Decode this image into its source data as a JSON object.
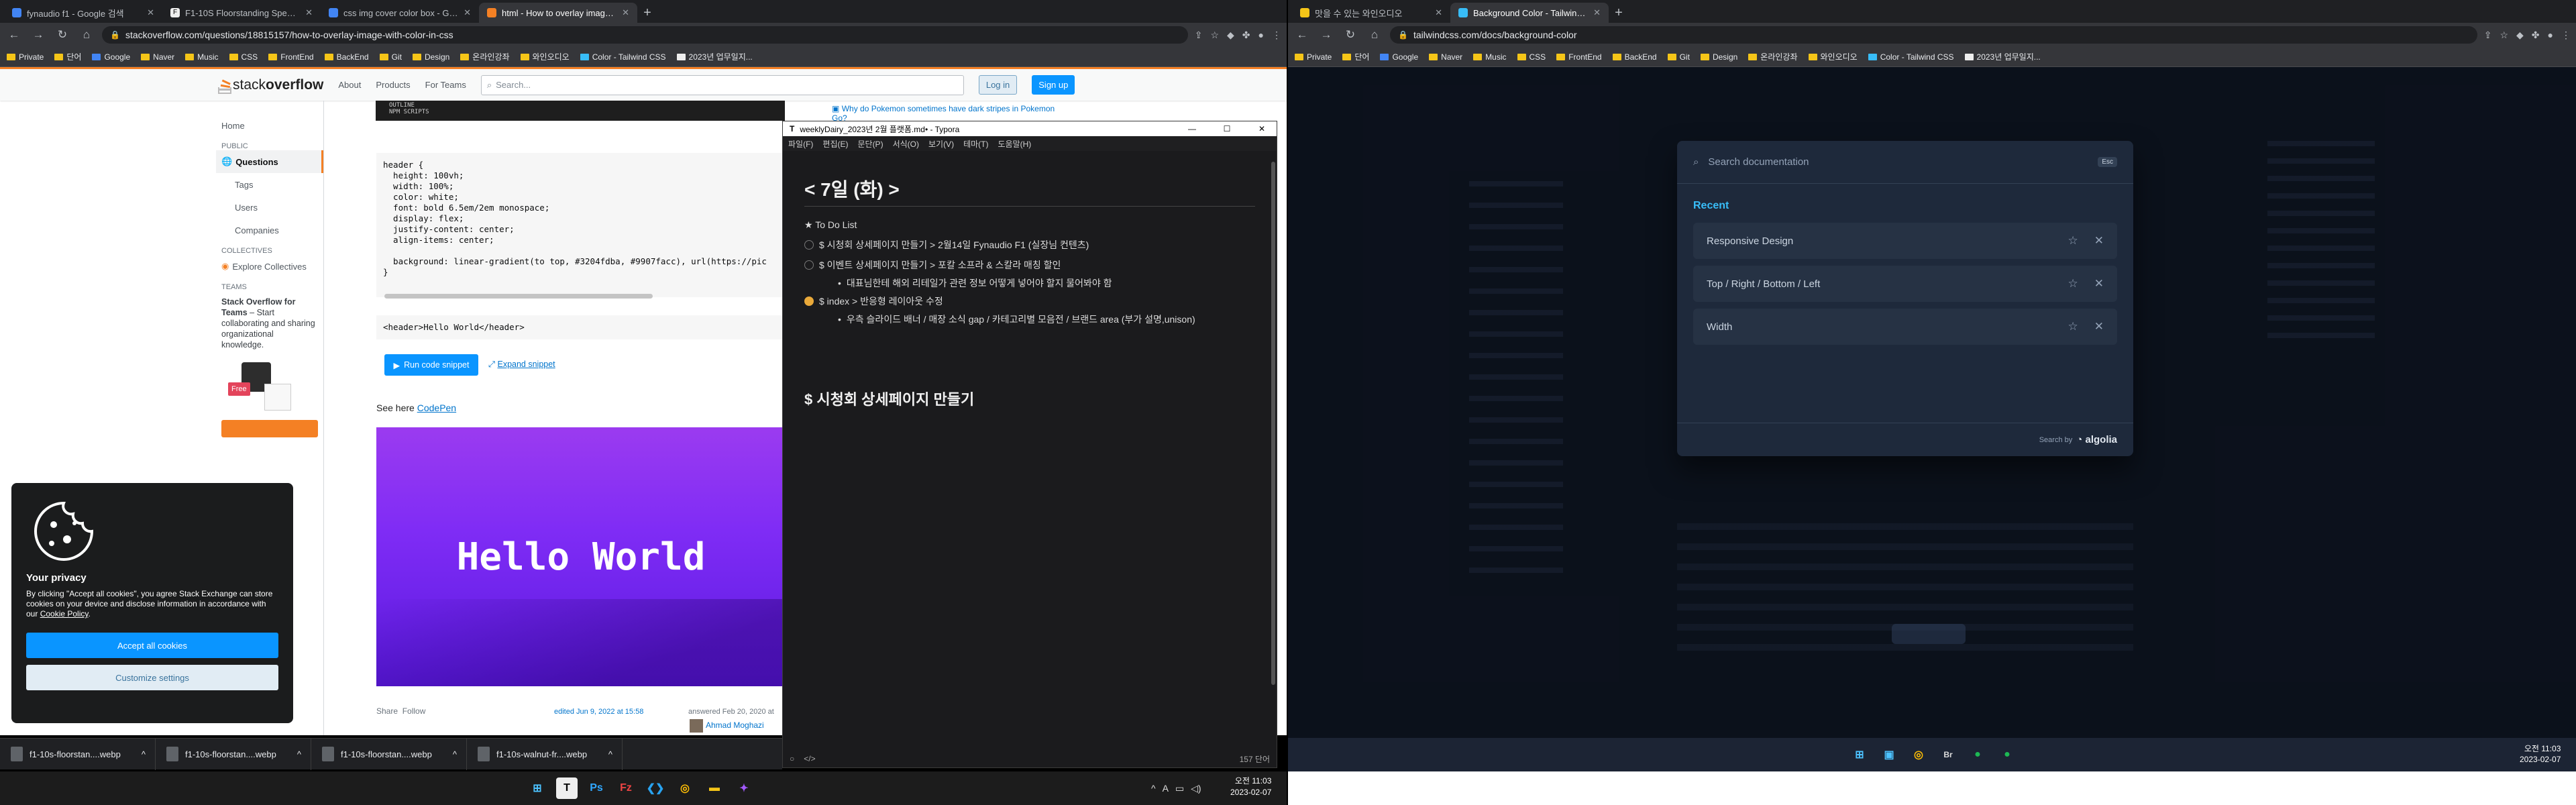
{
  "left_browser": {
    "tabs": [
      {
        "label": "fynaudio f1 - Google 검색",
        "color": "#4285f4"
      },
      {
        "label": "F1-10S Floorstanding Speaker |",
        "color": "#333333"
      },
      {
        "label": "css img cover color box - Goo...",
        "color": "#4285f4"
      },
      {
        "label": "html - How to overlay image w...",
        "color": "#f48024"
      }
    ],
    "url": "stackoverflow.com/questions/18815157/how-to-overlay-image-with-color-in-css",
    "bookmarks": [
      "Private",
      "단어",
      "Google",
      "Naver",
      "Music",
      "CSS",
      "FrontEnd",
      "BackEnd",
      "Git",
      "Design",
      "온라인강좌",
      "와인오디오",
      "Color - Tailwind CSS",
      "2023년 업무일지..."
    ]
  },
  "stackoverflow": {
    "logo_text_plain": "stack",
    "logo_text_bold": "overflow",
    "nav": [
      "About",
      "Products",
      "For Teams"
    ],
    "search_placeholder": "Search...",
    "login": "Log in",
    "signup": "Sign up",
    "sidebar": {
      "home": "Home",
      "public_header": "PUBLIC",
      "questions": "Questions",
      "tags": "Tags",
      "users": "Users",
      "companies": "Companies",
      "collectives_header": "COLLECTIVES",
      "explore_collectives": "Explore Collectives",
      "teams_header": "TEAMS",
      "teams_title": "Stack Overflow for Teams",
      "teams_text": " – Start collaborating and sharing organizational knowledge.",
      "free_badge": "Free"
    },
    "code_lines": [
      "header {",
      "  height: 100vh;",
      "  width: 100%;",
      "  color: white;",
      "  font: bold 6.5em/2em monospace;",
      "  display: flex;",
      "  justify-content: center;",
      "  align-items: center;",
      "",
      "  background: linear-gradient(to top, #3204fdba, #9907facc), url(https://pic",
      "}"
    ],
    "html_snippet": "<header>Hello World</header>",
    "run_button": "Run code snippet",
    "expand_link": "Expand snippet",
    "see_here": "See here ",
    "codepen": "CodePen",
    "preview_text": "Hello World",
    "share": "Share",
    "follow": "Follow",
    "edited": "edited Jun 9, 2022 at 15:58",
    "answered": "answered Feb 20, 2020 at",
    "answer_user": "Ahmad Moghazi",
    "hot_question": "Why do Pokemon sometimes have dark stripes in Pokemon Go?",
    "vscode_caption_1": "OUTLINE",
    "vscode_caption_2": "NPM SCRIPTS"
  },
  "cookie_banner": {
    "title": "Your privacy",
    "text_before_link": "By clicking \"Accept all cookies\", you agree Stack Exchange can store cookies on your device and disclose information in accordance with our ",
    "link": "Cookie Policy",
    "accept": "Accept all cookies",
    "customize": "Customize settings"
  },
  "typora": {
    "title": "weeklyDairy_2023년 2월 플랫폼.md• - Typora",
    "menu": [
      "파일(F)",
      "편집(E)",
      "문단(P)",
      "서식(O)",
      "보기(V)",
      "테마(T)",
      "도움말(H)"
    ],
    "h1": "< 7일 (화) >",
    "todo_title": "★ To Do List",
    "items": [
      {
        "text": "$ 시청회 상세페이지 만들기 > 2월14일 Fynaudio F1 (실장님 컨텐츠)",
        "checked": false
      },
      {
        "text": "$ 이벤트 상세페이지 만들기 > 포칼 소프라 & 스칼라 매칭 할인",
        "checked": false
      },
      {
        "text": "대표님한테 해외 리테일가 관련 정보 어떻게 넣어야 할지 물어봐야 함",
        "checked": null
      },
      {
        "text": "$ index > 반응형 레이아웃 수정",
        "checked": true
      },
      {
        "text": "우측 슬라이드 배너 / 매장 소식 gap / 카테고리별 모음전 / 브랜드 area (부가 설명,unison)",
        "checked": null
      }
    ],
    "h2": "$ 시청회 상세페이지 만들기",
    "word_count": "157 단어"
  },
  "downloads": [
    "f1-10s-floorstan....webp",
    "f1-10s-floorstan....webp",
    "f1-10s-floorstan....webp",
    "f1-10s-walnut-fr....webp"
  ],
  "left_clock": {
    "time": "오전 11:03",
    "date": "2023-02-07"
  },
  "right_browser": {
    "tabs": [
      {
        "label": "맛을 수 있는 와인오디오",
        "color": "#f5c518"
      },
      {
        "label": "Background Color - Tailwind CS",
        "color": "#38bdf8"
      }
    ],
    "url": "tailwindcss.com/docs/background-color",
    "bookmarks": [
      "Private",
      "단어",
      "Google",
      "Naver",
      "Music",
      "CSS",
      "FrontEnd",
      "BackEnd",
      "Git",
      "Design",
      "온라인강좌",
      "와인오디오",
      "Color - Tailwind CSS",
      "2023년 업무일지..."
    ]
  },
  "tailwind": {
    "search_placeholder": "Search documentation",
    "esc": "Esc",
    "recent_header": "Recent",
    "recent": [
      "Responsive Design",
      "Top / Right / Bottom / Left",
      "Width"
    ],
    "search_by": "Search by",
    "algolia": "algolia"
  },
  "right_clock": {
    "time": "오전 11:03",
    "date": "2023-02-07"
  }
}
